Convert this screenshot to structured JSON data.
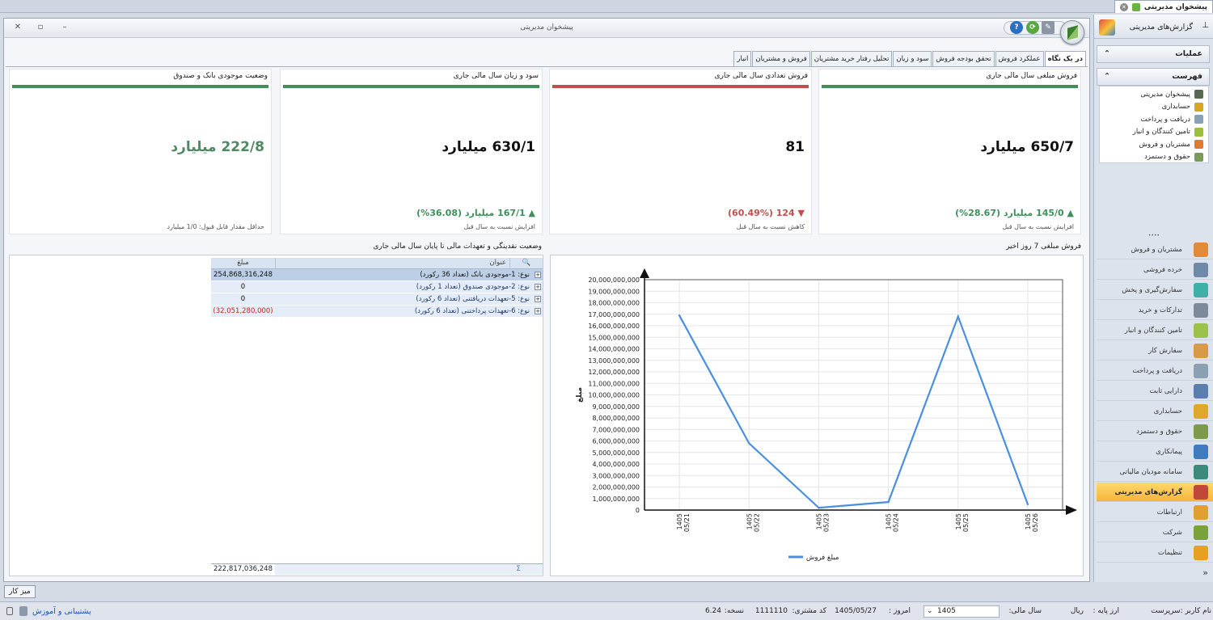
{
  "topbar": {
    "doc_tab": "پیشخوان مدیریتی"
  },
  "window": {
    "title": "پیشخوان مدیریتی",
    "tabs": [
      "در یک نگاه",
      "عملکرد فروش",
      "تحقق بودجه فروش",
      "سود و زیان",
      "تحلیل رفتار خرید مشتریان",
      "فروش و مشتریان",
      "انبار"
    ]
  },
  "cards": [
    {
      "title": "فروش مبلغی سال مالی جاری",
      "value": "650/7 میلیارد",
      "change": "▲ 145/0 میلیارد (28.67%)",
      "sub": "افزایش نسبت به سال قبل",
      "bar_color": "#3f8f5a",
      "value_color": "#111",
      "change_color": "#3f8f5a"
    },
    {
      "title": "فروش تعدادی سال مالی جاری",
      "value": "81",
      "change": "▼ 124 (60.49%)",
      "sub": "کاهش نسبت به سال قبل",
      "bar_color": "#c0504d",
      "value_color": "#111",
      "change_color": "#c0504d"
    },
    {
      "title": "سود و زیان سال مالی جاری",
      "value": "630/1 میلیارد",
      "change": "▲ 167/1 میلیارد (36.08%)",
      "sub": "افزایش نسبت به سال قبل",
      "bar_color": "#3f8f5a",
      "value_color": "#111",
      "change_color": "#3f8f5a"
    },
    {
      "title": "وضعیت موجودی بانک و صندوق",
      "value": "222/8 میلیارد",
      "change": "",
      "sub": "حداقل مقدار قابل قبول: 1/0 میلیارد",
      "bar_color": "#3f8f5a",
      "value_color": "#4d8a63",
      "change_color": "#3f8f5a"
    }
  ],
  "liquidity": {
    "title": "وضعیت نقدینگی و تعهدات مالی تا پایان سال مالی جاری",
    "col_title": "عنوان",
    "col_amount": "مبلغ",
    "rows": [
      {
        "label": "نوع: 1-موجودی بانک (تعداد 36 رکورد)",
        "amount": "254,868,316,248"
      },
      {
        "label": "نوع: 2-موجودی صندوق (تعداد 1 رکورد)",
        "amount": "0"
      },
      {
        "label": "نوع: 5-تعهدات دریافتنی (تعداد 6 رکورد)",
        "amount": "0"
      },
      {
        "label": "نوع: 6-تعهدات پرداختنی (تعداد 6 رکورد)",
        "amount": "(32,051,280,000)"
      }
    ],
    "total": "222,817,036,248"
  },
  "chart_panel_title": "فروش مبلغی 7 روز اخیر",
  "chart_data": {
    "type": "line",
    "categories": [
      "1405\n05/21",
      "1405\n05/22",
      "1405\n05/23",
      "1405\n05/24",
      "1405\n05/25",
      "1405\n05/26"
    ],
    "series": [
      {
        "name": "مبلغ فروش",
        "values": [
          16900000000,
          5800000000,
          200000000,
          700000000,
          16800000000,
          500000000
        ],
        "color": "#4a90e2"
      }
    ],
    "ylabel": "مبلغ",
    "ylim": [
      0,
      20000000000
    ],
    "ytick_step": 1000000000,
    "grid": true,
    "legend": "bottom"
  },
  "sidebar": {
    "header": "گزارش‌های مدیریتی",
    "ops": "عملیات",
    "list_header": "فهرست",
    "list": [
      {
        "label": "پیشخوان مدیریتی",
        "color": "#5a6a52"
      },
      {
        "label": "حسابداری",
        "color": "#d9a520"
      },
      {
        "label": "دریافت و پرداخت",
        "color": "#8aa0b5"
      },
      {
        "label": "تامین کنندگان و انبار",
        "color": "#9bbf3d"
      },
      {
        "label": "مشتریان و فروش",
        "color": "#e07a30"
      },
      {
        "label": "حقوق و دستمزد",
        "color": "#7a9a5a"
      }
    ],
    "modules": [
      {
        "label": "مشتریان و فروش",
        "color": "#e08a3a",
        "active": false
      },
      {
        "label": "خرده فروشی",
        "color": "#6f89a8",
        "active": false
      },
      {
        "label": "سفارش‌گیری و پخش",
        "color": "#3fb0a8",
        "active": false
      },
      {
        "label": "تدارکات و خرید",
        "color": "#7c8a9a",
        "active": false
      },
      {
        "label": "تامین کنندگان و انبار",
        "color": "#9cc24a",
        "active": false
      },
      {
        "label": "سفارش کار",
        "color": "#d79a45",
        "active": false
      },
      {
        "label": "دریافت و پرداخت",
        "color": "#8ca0b4",
        "active": false
      },
      {
        "label": "دارایی ثابت",
        "color": "#5a7fae",
        "active": false
      },
      {
        "label": "حسابداری",
        "color": "#e0a82a",
        "active": false
      },
      {
        "label": "حقوق و دستمزد",
        "color": "#7c9b4a",
        "active": false
      },
      {
        "label": "پیمانکاری",
        "color": "#3e7bbf",
        "active": false
      },
      {
        "label": "سامانه مودیان مالیاتی",
        "color": "#3c8a7a",
        "active": false
      },
      {
        "label": "گزارش‌های مدیریتی",
        "color": "#c0483a",
        "active": true
      },
      {
        "label": "ارتباطات",
        "color": "#e0a030",
        "active": false
      },
      {
        "label": "شرکت",
        "color": "#7aa23a",
        "active": false
      },
      {
        "label": "تنظیمات",
        "color": "#e8a020",
        "active": false
      }
    ]
  },
  "desk_button": "میز کار",
  "status": {
    "user": "نام کاربر :سرپرست",
    "base_currency": "ارز پایه :",
    "currency": "ریال",
    "fiscal_year_label": "سال مالی:",
    "fiscal_year": "1405",
    "today_label": "امروز :",
    "today": "1405/05/27",
    "customer_code_label": "کد مشتری:",
    "customer_code": "1111110",
    "version_label": "نسخه:",
    "version": "6.24",
    "support": "پشتیبانی و آموزش"
  }
}
